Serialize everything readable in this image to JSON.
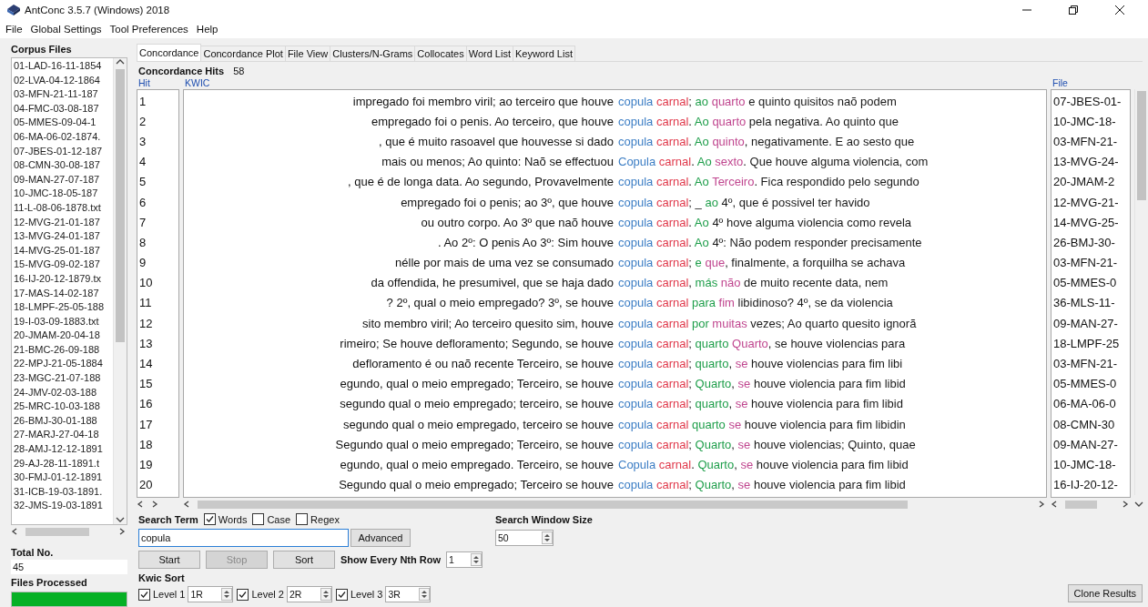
{
  "window": {
    "title": "AntConc 3.5.7 (Windows) 2018"
  },
  "menu": [
    "File",
    "Global Settings",
    "Tool Preferences",
    "Help"
  ],
  "corpus_files": {
    "title": "Corpus Files",
    "items": [
      "01-LAD-16-11-1854",
      "02-LVA-04-12-1864",
      "03-MFN-21-11-187",
      "04-FMC-03-08-187",
      "05-MMES-09-04-1",
      "06-MA-06-02-1874.",
      "07-JBES-01-12-187",
      "08-CMN-30-08-187",
      "09-MAN-27-07-187",
      "10-JMC-18-05-187",
      "11-L-08-06-1878.txt",
      "12-MVG-21-01-187",
      "13-MVG-24-01-187",
      "14-MVG-25-01-187",
      "15-MVG-09-02-187",
      "16-IJ-20-12-1879.tx",
      "17-MAS-14-02-187",
      "18-LMPF-25-05-188",
      "19-I-03-09-1883.txt",
      "20-JMAM-20-04-18",
      "21-BMC-26-09-188",
      "22-MPJ-21-05-1884",
      "23-MGC-21-07-188",
      "24-JMV-02-03-188",
      "25-MRC-10-03-188",
      "26-BMJ-30-01-188",
      "27-MARJ-27-04-18",
      "28-AMJ-12-12-1891",
      "29-AJ-28-11-1891.t",
      "30-FMJ-01-12-1891",
      "31-ICB-19-03-1891.",
      "32-JMS-19-03-1891"
    ]
  },
  "total": {
    "label": "Total No.",
    "value": "45"
  },
  "files_processed": {
    "label": "Files Processed",
    "level": 1
  },
  "tabs": [
    {
      "label": "Concordance",
      "selected": true
    },
    {
      "label": "Concordance Plot",
      "selected": false
    },
    {
      "label": "File View",
      "selected": false
    },
    {
      "label": "Clusters/N-Grams",
      "selected": false
    },
    {
      "label": "Collocates",
      "selected": false
    },
    {
      "label": "Word List",
      "selected": false
    },
    {
      "label": "Keyword List",
      "selected": false
    }
  ],
  "hits": {
    "label": "Concordance Hits",
    "value": "58"
  },
  "columns": [
    "Hit",
    "KWIC",
    "File"
  ],
  "rows": [
    {
      "hit": "1",
      "left": "impregado foi membro viril; ao terceiro que houve",
      "right": [
        {
          "text": "copula ",
          "kind": "node"
        },
        {
          "text": "carnal",
          "kind": "r1"
        },
        {
          "text": "; ",
          "kind": "plain"
        },
        {
          "text": "ao ",
          "kind": "r2"
        },
        {
          "text": "quarto",
          "kind": "r3"
        },
        {
          "text": " e quinto quisitos naõ podem",
          "kind": "plain"
        }
      ],
      "file": "07-JBES-01-"
    },
    {
      "hit": "2",
      "left": "empregado foi o penis. Ao terceiro, que houve",
      "right": [
        {
          "text": "copula ",
          "kind": "node"
        },
        {
          "text": "carnal",
          "kind": "r1"
        },
        {
          "text": ". ",
          "kind": "plain"
        },
        {
          "text": "Ao ",
          "kind": "r2"
        },
        {
          "text": "quarto",
          "kind": "r3"
        },
        {
          "text": " pela negativa. Ao quinto que",
          "kind": "plain"
        }
      ],
      "file": "10-JMC-18-"
    },
    {
      "hit": "3",
      "left": ", que é muito rasoavel que houvesse si dado",
      "right": [
        {
          "text": "copula ",
          "kind": "node"
        },
        {
          "text": "carnal",
          "kind": "r1"
        },
        {
          "text": ". ",
          "kind": "plain"
        },
        {
          "text": "Ao ",
          "kind": "r2"
        },
        {
          "text": "quinto",
          "kind": "r3"
        },
        {
          "text": ", negativamente. E ao sesto que",
          "kind": "plain"
        }
      ],
      "file": "03-MFN-21-"
    },
    {
      "hit": "4",
      "left": "mais ou menos; Ao quinto: Naõ se effectuou",
      "right": [
        {
          "text": "Copula ",
          "kind": "node"
        },
        {
          "text": "carnal",
          "kind": "r1"
        },
        {
          "text": ". ",
          "kind": "plain"
        },
        {
          "text": "Ao ",
          "kind": "r2"
        },
        {
          "text": "sexto",
          "kind": "r3"
        },
        {
          "text": ". Que houve alguma violencia, com",
          "kind": "plain"
        }
      ],
      "file": "13-MVG-24-"
    },
    {
      "hit": "5",
      "left": ", que é de longa data.  Ao segundo, Provavelmente",
      "right": [
        {
          "text": "copula ",
          "kind": "node"
        },
        {
          "text": "carnal",
          "kind": "r1"
        },
        {
          "text": ". ",
          "kind": "plain"
        },
        {
          "text": "Ao ",
          "kind": "r2"
        },
        {
          "text": "Terceiro",
          "kind": "r3"
        },
        {
          "text": ". Fica respondido pelo segundo",
          "kind": "plain"
        }
      ],
      "file": "20-JMAM-2"
    },
    {
      "hit": "6",
      "left": "empregado foi o penis; ao 3º, que houve",
      "right": [
        {
          "text": "copula ",
          "kind": "node"
        },
        {
          "text": "carnal",
          "kind": "r1"
        },
        {
          "text": "; _ ",
          "kind": "plain"
        },
        {
          "text": "ao",
          "kind": "r2"
        },
        {
          "text": " 4º, que é possivel ter havido",
          "kind": "plain"
        }
      ],
      "file": "12-MVG-21-"
    },
    {
      "hit": "7",
      "left": "ou outro corpo.  Ao 3º que naõ houve",
      "right": [
        {
          "text": "copula ",
          "kind": "node"
        },
        {
          "text": "carnal",
          "kind": "r1"
        },
        {
          "text": ". ",
          "kind": "plain"
        },
        {
          "text": "Ao ",
          "kind": "r2"
        },
        {
          "text": "4º hove alguma violencia como revela",
          "kind": "plain"
        }
      ],
      "file": "14-MVG-25-"
    },
    {
      "hit": "8",
      "left": ".  Ao 2º: O penis Ao 3º: Sim houve",
      "right": [
        {
          "text": "copula ",
          "kind": "node"
        },
        {
          "text": "carnal",
          "kind": "r1"
        },
        {
          "text": ".  ",
          "kind": "plain"
        },
        {
          "text": "Ao ",
          "kind": "r2"
        },
        {
          "text": "4º: Não podem responder precisamente",
          "kind": "plain"
        }
      ],
      "file": "26-BMJ-30-"
    },
    {
      "hit": "9",
      "left": "nélle por mais de uma vez se consumado",
      "right": [
        {
          "text": "copula ",
          "kind": "node"
        },
        {
          "text": "carnal",
          "kind": "r1"
        },
        {
          "text": "; ",
          "kind": "plain"
        },
        {
          "text": "e ",
          "kind": "r2"
        },
        {
          "text": "que",
          "kind": "r3"
        },
        {
          "text": ", finalmente, a forquilha se achava",
          "kind": "plain"
        }
      ],
      "file": "03-MFN-21-"
    },
    {
      "hit": "10",
      "left": "da offendida, he presumivel, que se haja dado",
      "right": [
        {
          "text": "copula ",
          "kind": "node"
        },
        {
          "text": "carnal",
          "kind": "r1"
        },
        {
          "text": ", ",
          "kind": "plain"
        },
        {
          "text": "más ",
          "kind": "r2"
        },
        {
          "text": "não",
          "kind": "r3"
        },
        {
          "text": " de muito recente data, nem",
          "kind": "plain"
        }
      ],
      "file": "05-MMES-0"
    },
    {
      "hit": "11",
      "left": "? 2º, qual o meio empregado? 3º, se houve",
      "right": [
        {
          "text": "copula ",
          "kind": "node"
        },
        {
          "text": "carnal ",
          "kind": "r1"
        },
        {
          "text": "para ",
          "kind": "r2"
        },
        {
          "text": "fim",
          "kind": "r3"
        },
        {
          "text": " libidinoso?  4º, se da violencia",
          "kind": "plain"
        }
      ],
      "file": "36-MLS-11-"
    },
    {
      "hit": "12",
      "left": "sito membro viril; Ao terceiro quesito sim, houve",
      "right": [
        {
          "text": "copula ",
          "kind": "node"
        },
        {
          "text": "carnal ",
          "kind": "r1"
        },
        {
          "text": "por ",
          "kind": "r2"
        },
        {
          "text": "muitas",
          "kind": "r3"
        },
        {
          "text": " vezes; Ao quarto quesito ignorã",
          "kind": "plain"
        }
      ],
      "file": "09-MAN-27-"
    },
    {
      "hit": "13",
      "left": "rimeiro; Se houve defloramento; Segundo, se houve",
      "right": [
        {
          "text": "copula ",
          "kind": "node"
        },
        {
          "text": "carnal",
          "kind": "r1"
        },
        {
          "text": "; ",
          "kind": "plain"
        },
        {
          "text": "quarto  ",
          "kind": "r2"
        },
        {
          "text": "Quarto",
          "kind": "r3"
        },
        {
          "text": ", se houve violencias para",
          "kind": "plain"
        }
      ],
      "file": "18-LMPF-25"
    },
    {
      "hit": "14",
      "left": "defloramento é ou naõ recente  Terceiro, se houve",
      "right": [
        {
          "text": "copula ",
          "kind": "node"
        },
        {
          "text": "carnal",
          "kind": "r1"
        },
        {
          "text": "; ",
          "kind": "plain"
        },
        {
          "text": "quarto",
          "kind": "r2"
        },
        {
          "text": ", ",
          "kind": "plain"
        },
        {
          "text": "se",
          "kind": "r3"
        },
        {
          "text": " houve violencias para fim libi",
          "kind": "plain"
        }
      ],
      "file": "03-MFN-21-"
    },
    {
      "hit": "15",
      "left": "egundo, qual o meio empregado; Terceiro, se houve",
      "right": [
        {
          "text": "copula ",
          "kind": "node"
        },
        {
          "text": "carnal",
          "kind": "r1"
        },
        {
          "text": "; ",
          "kind": "plain"
        },
        {
          "text": "Quarto",
          "kind": "r2"
        },
        {
          "text": ", ",
          "kind": "plain"
        },
        {
          "text": "se",
          "kind": "r3"
        },
        {
          "text": " houve violencia para fim libid",
          "kind": "plain"
        }
      ],
      "file": "05-MMES-0"
    },
    {
      "hit": "16",
      "left": "segundo qual o meio empregado; terceiro, se houve",
      "right": [
        {
          "text": "copula ",
          "kind": "node"
        },
        {
          "text": "carnal",
          "kind": "r1"
        },
        {
          "text": "; ",
          "kind": "plain"
        },
        {
          "text": "quarto",
          "kind": "r2"
        },
        {
          "text": ", ",
          "kind": "plain"
        },
        {
          "text": "se",
          "kind": "r3"
        },
        {
          "text": " houve violencia para fim libid",
          "kind": "plain"
        }
      ],
      "file": "06-MA-06-0"
    },
    {
      "hit": "17",
      "left": "segundo qual o meio empregado, terceiro se houve",
      "right": [
        {
          "text": "copula ",
          "kind": "node"
        },
        {
          "text": "carnal ",
          "kind": "r1"
        },
        {
          "text": "quarto ",
          "kind": "r2"
        },
        {
          "text": "se",
          "kind": "r3"
        },
        {
          "text": " houve violencia para fim libidin",
          "kind": "plain"
        }
      ],
      "file": "08-CMN-30"
    },
    {
      "hit": "18",
      "left": "Segundo qual o meio empregado; Terceiro, se houve",
      "right": [
        {
          "text": "copula ",
          "kind": "node"
        },
        {
          "text": "carnal",
          "kind": "r1"
        },
        {
          "text": "; ",
          "kind": "plain"
        },
        {
          "text": "Quarto",
          "kind": "r2"
        },
        {
          "text": ", ",
          "kind": "plain"
        },
        {
          "text": "se",
          "kind": "r3"
        },
        {
          "text": " houve violencias; Quinto, quae",
          "kind": "plain"
        }
      ],
      "file": "09-MAN-27-"
    },
    {
      "hit": "19",
      "left": "egundo, qual o meio empregado. Terceiro, se houve",
      "right": [
        {
          "text": "Copula ",
          "kind": "node"
        },
        {
          "text": "carnal",
          "kind": "r1"
        },
        {
          "text": ". ",
          "kind": "plain"
        },
        {
          "text": "Quarto",
          "kind": "r2"
        },
        {
          "text": ", ",
          "kind": "plain"
        },
        {
          "text": "se",
          "kind": "r3"
        },
        {
          "text": " houve violencia para fim libid",
          "kind": "plain"
        }
      ],
      "file": "10-JMC-18-"
    },
    {
      "hit": "20",
      "left": "Segundo qual o meio empregado; Terceiro se houve",
      "right": [
        {
          "text": "copula ",
          "kind": "node"
        },
        {
          "text": "carnal",
          "kind": "r1"
        },
        {
          "text": "; ",
          "kind": "plain"
        },
        {
          "text": "Quarto",
          "kind": "r2"
        },
        {
          "text": ", ",
          "kind": "plain"
        },
        {
          "text": "se",
          "kind": "r3"
        },
        {
          "text": " houve violencia para fim libid",
          "kind": "plain"
        }
      ],
      "file": "16-IJ-20-12-"
    }
  ],
  "search": {
    "label": "Search Term",
    "options": [
      {
        "label": "Words",
        "checked": true
      },
      {
        "label": "Case",
        "checked": false
      },
      {
        "label": "Regex",
        "checked": false
      }
    ],
    "value": "copula",
    "advanced": "Advanced"
  },
  "window_size": {
    "label": "Search Window Size",
    "value": "50"
  },
  "actions": [
    {
      "label": "Start",
      "disabled": false
    },
    {
      "label": "Stop",
      "disabled": true
    },
    {
      "label": "Sort",
      "disabled": false
    }
  ],
  "nth_row": {
    "label": "Show Every Nth Row",
    "value": "1"
  },
  "kwic_sort": {
    "label": "Kwic Sort",
    "levels": [
      {
        "label": "Level 1",
        "checked": true,
        "value": "1R"
      },
      {
        "label": "Level 2",
        "checked": true,
        "value": "2R"
      },
      {
        "label": "Level 3",
        "checked": true,
        "value": "3R"
      }
    ]
  },
  "clone": "Clone Results"
}
